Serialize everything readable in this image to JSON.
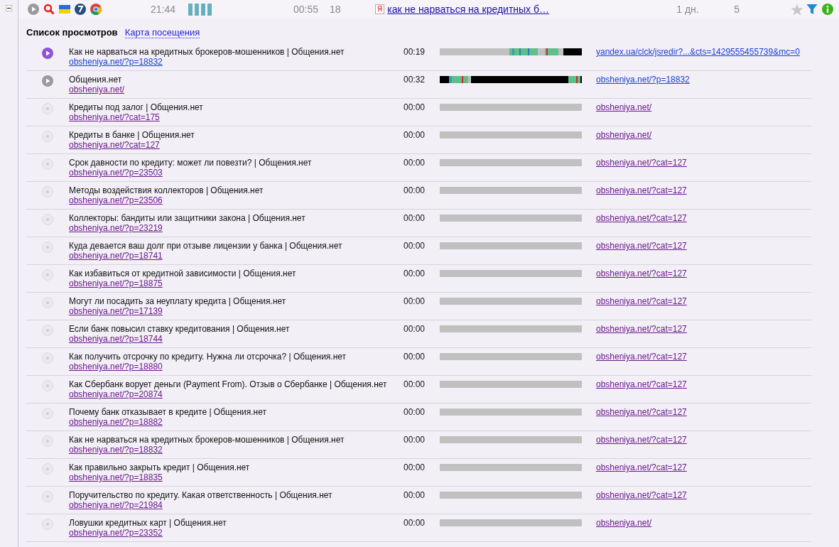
{
  "session": {
    "expanded": true,
    "time": "21:44",
    "engine_badge": "Я",
    "duration": "00:55",
    "views": "18",
    "source_title": "как не нарваться на кредитных б…",
    "age": "1 дн.",
    "count": "5",
    "starred": false
  },
  "tabs": [
    {
      "label": "Список просмотров",
      "selected": true
    },
    {
      "label": "Карта посещения",
      "selected": false
    }
  ],
  "rows": [
    {
      "kind": "active",
      "title": "Как не нарваться на кредитных брокеров-мошенников | Общения.нет",
      "url": "obsheniya.net/?p=18832",
      "url_visited": false,
      "time": "00:19",
      "referrer": "yandex.ua/clck/jsredir?...&cts=1429555455739&mc=0",
      "referrer_visited": false
    },
    {
      "kind": "played",
      "title": "Общения.нет",
      "url": "obsheniya.net/",
      "url_visited": true,
      "time": "00:32",
      "referrer": "obsheniya.net/?p=18832",
      "referrer_visited": false
    },
    {
      "kind": "idle",
      "title": "Кредиты под залог | Общения.нет",
      "url": "obsheniya.net/?cat=175",
      "url_visited": true,
      "time": "00:00",
      "referrer": "obsheniya.net/",
      "referrer_visited": true
    },
    {
      "kind": "idle",
      "title": "Кредиты в банке | Общения.нет",
      "url": "obsheniya.net/?cat=127",
      "url_visited": true,
      "time": "00:00",
      "referrer": "obsheniya.net/",
      "referrer_visited": true
    },
    {
      "kind": "idle",
      "title": "Срок давности по кредиту: может ли повезти? | Общения.нет",
      "url": "obsheniya.net/?p=23503",
      "url_visited": true,
      "time": "00:00",
      "referrer": "obsheniya.net/?cat=127",
      "referrer_visited": true
    },
    {
      "kind": "idle",
      "title": "Методы воздействия коллекторов | Общения.нет",
      "url": "obsheniya.net/?p=23506",
      "url_visited": true,
      "time": "00:00",
      "referrer": "obsheniya.net/?cat=127",
      "referrer_visited": true
    },
    {
      "kind": "idle",
      "title": "Коллекторы: бандиты или защитники закона | Общения.нет",
      "url": "obsheniya.net/?p=23219",
      "url_visited": true,
      "time": "00:00",
      "referrer": "obsheniya.net/?cat=127",
      "referrer_visited": true
    },
    {
      "kind": "idle",
      "title": "Куда девается ваш долг при отзыве лицензии у банка | Общения.нет",
      "url": "obsheniya.net/?p=18741",
      "url_visited": true,
      "time": "00:00",
      "referrer": "obsheniya.net/?cat=127",
      "referrer_visited": true
    },
    {
      "kind": "idle",
      "title": "Как избавиться от кредитной зависимости | Общения.нет",
      "url": "obsheniya.net/?p=18875",
      "url_visited": true,
      "time": "00:00",
      "referrer": "obsheniya.net/?cat=127",
      "referrer_visited": true
    },
    {
      "kind": "idle",
      "title": "Могут ли посадить за неуплату кредита | Общения.нет",
      "url": "obsheniya.net/?p=17139",
      "url_visited": true,
      "time": "00:00",
      "referrer": "obsheniya.net/?cat=127",
      "referrer_visited": true
    },
    {
      "kind": "idle",
      "title": "Если банк повысил ставку кредитования | Общения.нет",
      "url": "obsheniya.net/?p=18744",
      "url_visited": true,
      "time": "00:00",
      "referrer": "obsheniya.net/?cat=127",
      "referrer_visited": true
    },
    {
      "kind": "idle",
      "title": "Как получить отсрочку по кредиту. Нужна ли отсрочка? | Общения.нет",
      "url": "obsheniya.net/?p=18880",
      "url_visited": true,
      "time": "00:00",
      "referrer": "obsheniya.net/?cat=127",
      "referrer_visited": true
    },
    {
      "kind": "idle",
      "title": "Как Сбербанк ворует деньги (Payment From). Отзыв о Сбербанке | Общения.нет",
      "url": "obsheniya.net/?p=20874",
      "url_visited": true,
      "time": "00:00",
      "referrer": "obsheniya.net/?cat=127",
      "referrer_visited": true
    },
    {
      "kind": "idle",
      "title": "Почему банк отказывает в кредите | Общения.нет",
      "url": "obsheniya.net/?p=18882",
      "url_visited": true,
      "time": "00:00",
      "referrer": "obsheniya.net/?cat=127",
      "referrer_visited": true
    },
    {
      "kind": "idle",
      "title": "Как не нарваться на кредитных брокеров-мошенников | Общения.нет",
      "url": "obsheniya.net/?p=18832",
      "url_visited": true,
      "time": "00:00",
      "referrer": "obsheniya.net/?cat=127",
      "referrer_visited": true
    },
    {
      "kind": "idle",
      "title": "Как правильно закрыть кредит | Общения.нет",
      "url": "obsheniya.net/?p=18835",
      "url_visited": true,
      "time": "00:00",
      "referrer": "obsheniya.net/?cat=127",
      "referrer_visited": true
    },
    {
      "kind": "idle",
      "title": "Поручительство по кредиту. Какая ответственность | Общения.нет",
      "url": "obsheniya.net/?p=21984",
      "url_visited": true,
      "time": "00:00",
      "referrer": "obsheniya.net/?cat=127",
      "referrer_visited": true
    },
    {
      "kind": "idle",
      "title": "Ловушки кредитных карт | Общения.нет",
      "url": "obsheniya.net/?p=23352",
      "url_visited": true,
      "time": "00:00",
      "referrer": "obsheniya.net/",
      "referrer_visited": true
    }
  ]
}
